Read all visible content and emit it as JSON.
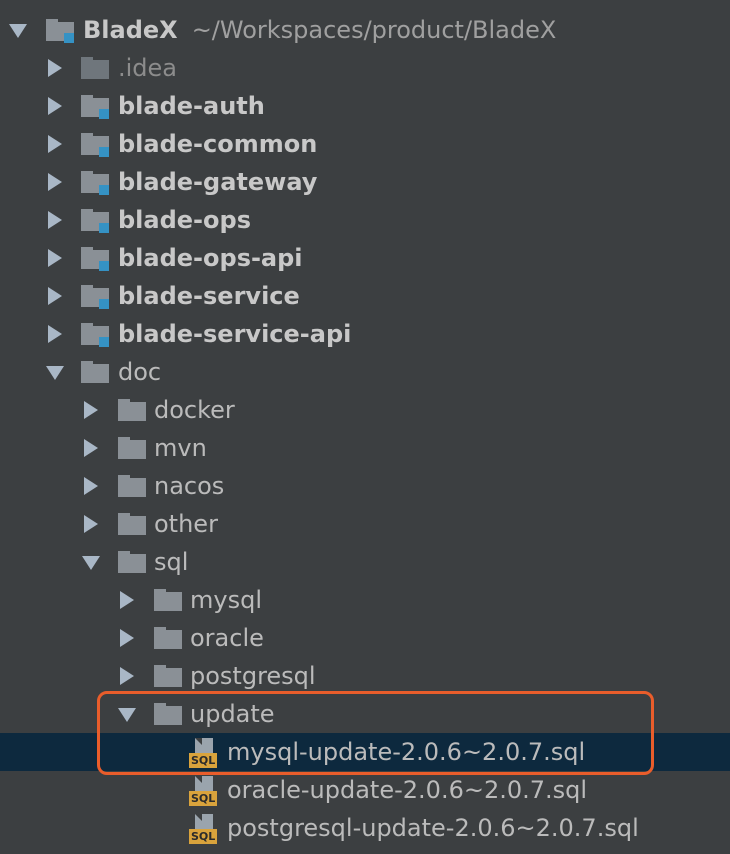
{
  "project": {
    "name": "BladeX",
    "path": "~/Workspaces/product/BladeX"
  },
  "modules": [
    {
      "label": ".idea"
    },
    {
      "label": "blade-auth"
    },
    {
      "label": "blade-common"
    },
    {
      "label": "blade-gateway"
    },
    {
      "label": "blade-ops"
    },
    {
      "label": "blade-ops-api"
    },
    {
      "label": "blade-service"
    },
    {
      "label": "blade-service-api"
    }
  ],
  "doc": {
    "label": "doc",
    "children": [
      {
        "label": "docker"
      },
      {
        "label": "mvn"
      },
      {
        "label": "nacos"
      },
      {
        "label": "other"
      },
      {
        "label": "sql"
      }
    ],
    "sql_children": [
      {
        "label": "mysql"
      },
      {
        "label": "oracle"
      },
      {
        "label": "postgresql"
      },
      {
        "label": "update"
      }
    ],
    "update_files": [
      {
        "label": "mysql-update-2.0.6~2.0.7.sql"
      },
      {
        "label": "oracle-update-2.0.6~2.0.7.sql"
      },
      {
        "label": "postgresql-update-2.0.6~2.0.7.sql"
      }
    ]
  },
  "sql_badge": "SQL",
  "colors": {
    "background": "#3c3f41",
    "selection": "#0d293e",
    "highlight_border": "#e95d2b",
    "module_badge": "#3592c4",
    "sql_tag": "#d9a33c"
  }
}
